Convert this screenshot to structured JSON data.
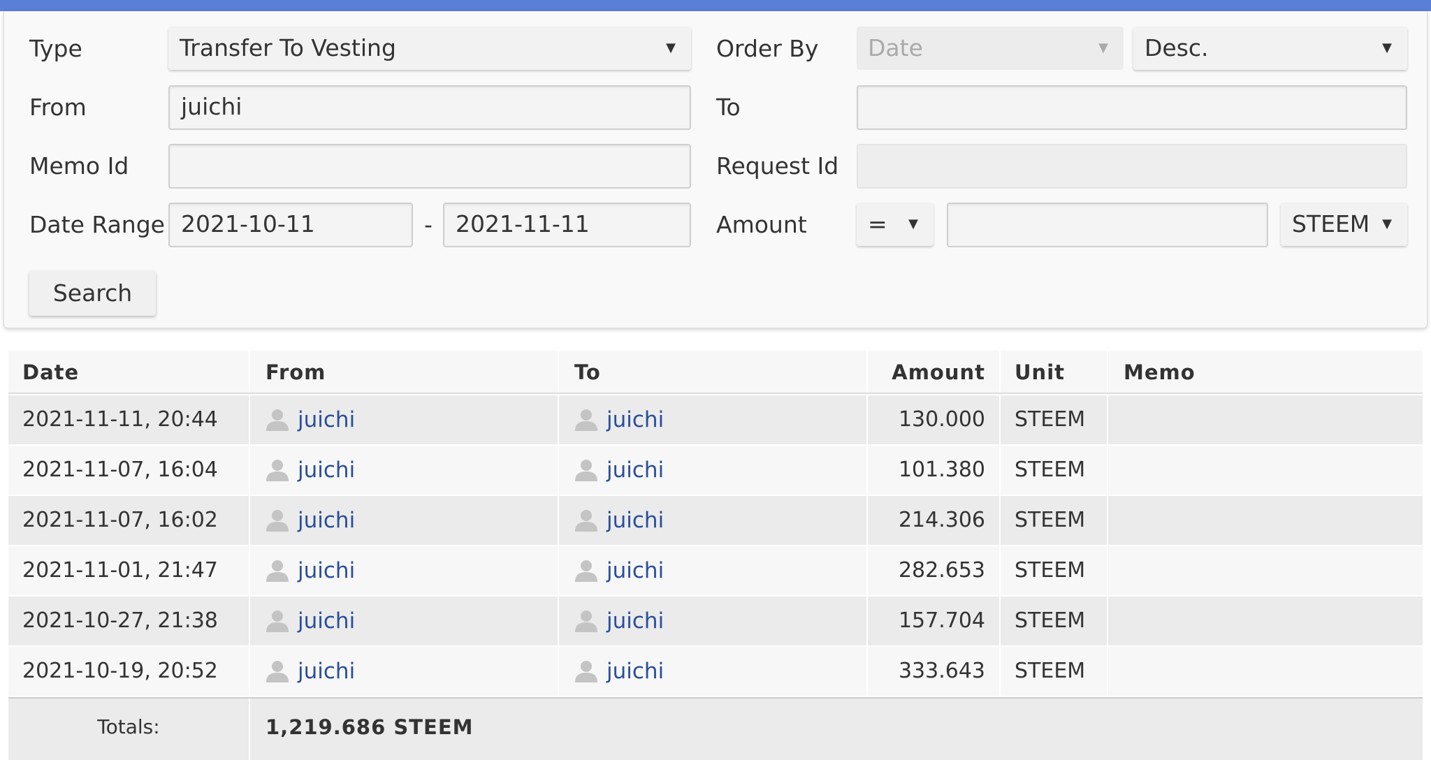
{
  "filters": {
    "type_label": "Type",
    "type_value": "Transfer To Vesting",
    "order_by_label": "Order By",
    "order_by_value": "Date",
    "order_dir_value": "Desc.",
    "from_label": "From",
    "from_value": "juichi",
    "to_label": "To",
    "to_value": "",
    "memo_id_label": "Memo Id",
    "memo_id_value": "",
    "request_id_label": "Request Id",
    "request_id_value": "",
    "date_range_label": "Date Range",
    "date_start": "2021-10-11",
    "date_separator": "-",
    "date_end": "2021-11-11",
    "amount_label": "Amount",
    "amount_operator": "=",
    "amount_value": "",
    "amount_unit": "STEEM",
    "search_label": "Search",
    "caret": "▼"
  },
  "table": {
    "headers": {
      "date": "Date",
      "from": "From",
      "to": "To",
      "amount": "Amount",
      "unit": "Unit",
      "memo": "Memo"
    },
    "rows": [
      {
        "date": "2021-11-11, 20:44",
        "from": "juichi",
        "to": "juichi",
        "amount": "130.000",
        "unit": "STEEM",
        "memo": ""
      },
      {
        "date": "2021-11-07, 16:04",
        "from": "juichi",
        "to": "juichi",
        "amount": "101.380",
        "unit": "STEEM",
        "memo": ""
      },
      {
        "date": "2021-11-07, 16:02",
        "from": "juichi",
        "to": "juichi",
        "amount": "214.306",
        "unit": "STEEM",
        "memo": ""
      },
      {
        "date": "2021-11-01, 21:47",
        "from": "juichi",
        "to": "juichi",
        "amount": "282.653",
        "unit": "STEEM",
        "memo": ""
      },
      {
        "date": "2021-10-27, 21:38",
        "from": "juichi",
        "to": "juichi",
        "amount": "157.704",
        "unit": "STEEM",
        "memo": ""
      },
      {
        "date": "2021-10-19, 20:52",
        "from": "juichi",
        "to": "juichi",
        "amount": "333.643",
        "unit": "STEEM",
        "memo": ""
      }
    ],
    "totals_label": "Totals:",
    "totals_value": "1,219.686 STEEM"
  },
  "colors": {
    "topbar": "#5a7fd6",
    "link": "#2a4e9a",
    "user_icon": "#c4c4c4"
  },
  "icons": {
    "user": "user-icon",
    "dropdown": "chevron-down-icon"
  }
}
